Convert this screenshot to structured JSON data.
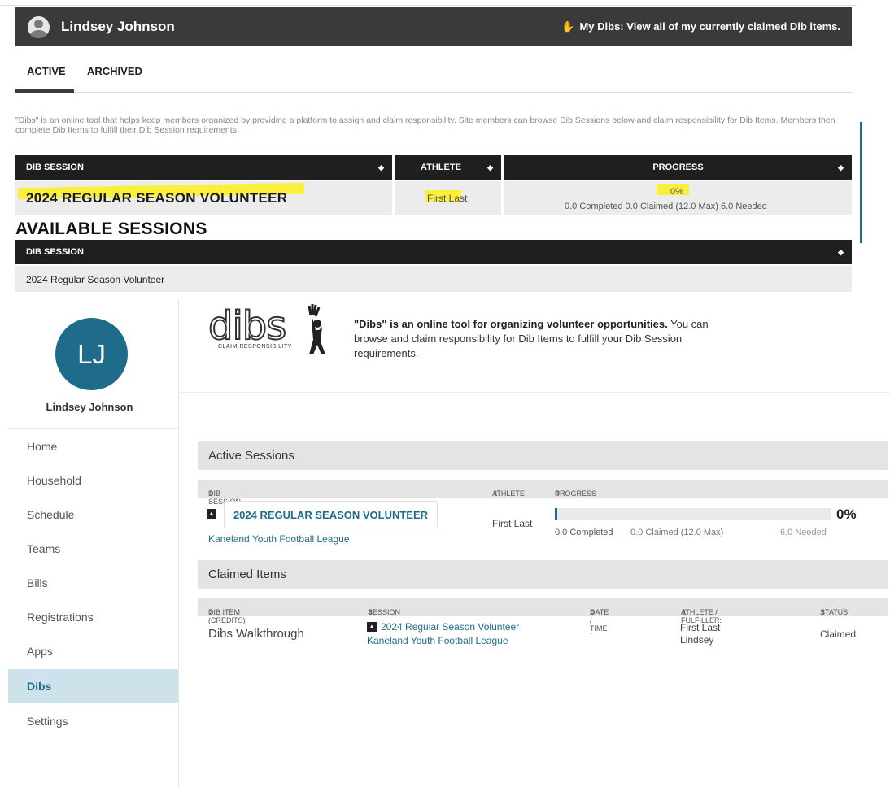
{
  "topbar": {
    "user_name": "Lindsey Johnson",
    "my_dibs": "My Dibs: View all of my currently claimed Dib items."
  },
  "tabs": [
    {
      "label": "ACTIVE",
      "active": true
    },
    {
      "label": "ARCHIVED",
      "active": false
    }
  ],
  "intro": "\"Dibs\" is an online tool that helps keep members organized by providing a platform to assign and claim responsibility. Site members can browse Dib Sessions below and claim responsibility for Dib Items. Members then complete Dib Items to fulfill their Dib Session requirements.",
  "my_sessions_table": {
    "headers": [
      "DIB SESSION",
      "ATHLETE",
      "PROGRESS"
    ],
    "row": {
      "session": "2024 REGULAR SEASON VOLUNTEER",
      "athlete": "First Last",
      "percent": "0%",
      "detail": "0.0 Completed 0.0 Claimed (12.0 Max) 6.0 Needed"
    }
  },
  "available": {
    "heading": "AVAILABLE SESSIONS",
    "header": "DIB SESSION",
    "rows": [
      "2024 Regular Season Volunteer"
    ]
  },
  "sidebar": {
    "initials": "LJ",
    "name": "Lindsey Johnson",
    "items": [
      {
        "label": "Home",
        "selected": false
      },
      {
        "label": "Household",
        "selected": false
      },
      {
        "label": "Schedule",
        "selected": false
      },
      {
        "label": "Teams",
        "selected": false
      },
      {
        "label": "Bills",
        "selected": false
      },
      {
        "label": "Registrations",
        "selected": false
      },
      {
        "label": "Apps",
        "selected": false
      },
      {
        "label": "Dibs",
        "selected": true
      },
      {
        "label": "Settings",
        "selected": false
      }
    ]
  },
  "logo": {
    "word": "dibs",
    "tagline": "CLAIM RESPONSIBILITY"
  },
  "blurb": {
    "bold": "\"Dibs\" is an online tool for organizing volunteer opportunities.",
    "rest": " You can browse and claim responsibility for Dib Items to fulfill your Dib Session requirements."
  },
  "active_sessions": {
    "title": "Active Sessions",
    "columns": [
      "DIB SESSION",
      "ATHLETE",
      "PROGRESS"
    ],
    "row": {
      "session": "2024 REGULAR SEASON VOLUNTEER",
      "league": "Kaneland Youth Football League",
      "athlete": "First Last",
      "percent": "0%",
      "progress_value": 0,
      "completed": "0.0 Completed",
      "claimed": "0.0 Claimed (12.0 Max)",
      "needed": "6.0 Needed"
    }
  },
  "claimed_items": {
    "title": "Claimed Items",
    "columns": [
      "DIB ITEM (CREDITS)",
      "SESSION",
      "DATE / TIME",
      "ATHLETE / FULFILLER:",
      "STATUS"
    ],
    "row": {
      "item": "Dibs Walkthrough",
      "session": "2024 Regular Season Volunteer",
      "league": "Kaneland Youth Football League",
      "date": "-",
      "athlete": "First Last",
      "fulfiller": "Lindsey",
      "status": "Claimed"
    }
  },
  "colors": {
    "accent": "#1e6b8a",
    "highlight": "#fff200",
    "header_dark": "#1f1f1f"
  }
}
